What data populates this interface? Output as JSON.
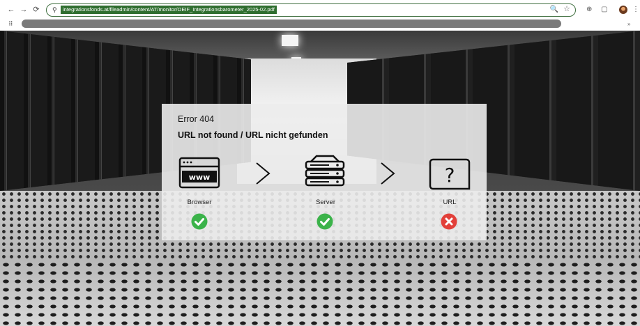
{
  "browser": {
    "back_glyph": "←",
    "forward_glyph": "→",
    "reload_glyph": "⟳",
    "tune_glyph": "⚲",
    "url": "integrationsfonds.at/fileadmin/content/AT/monitor/OEIF_Integrationsbarometer_2025-02.pdf",
    "zoom_glyph": "🔍",
    "star_glyph": "☆",
    "extensions_glyph": "⊕",
    "downloads_glyph": "▢",
    "menu_glyph": "⋮",
    "apps_glyph": "⠿",
    "more_glyph": "»",
    "accent_color": "#2f6e2f"
  },
  "error": {
    "code": "Error 404",
    "message": "URL not found / URL nicht gefunden"
  },
  "steps": [
    {
      "label": "Browser",
      "icon": "browser-window-icon",
      "status": "ok"
    },
    {
      "label": "Server",
      "icon": "server-icon",
      "status": "ok"
    },
    {
      "label": "URL",
      "icon": "question-mark-icon",
      "status": "error"
    }
  ],
  "colors": {
    "ok": "#3bb34a",
    "error": "#e2403a"
  }
}
